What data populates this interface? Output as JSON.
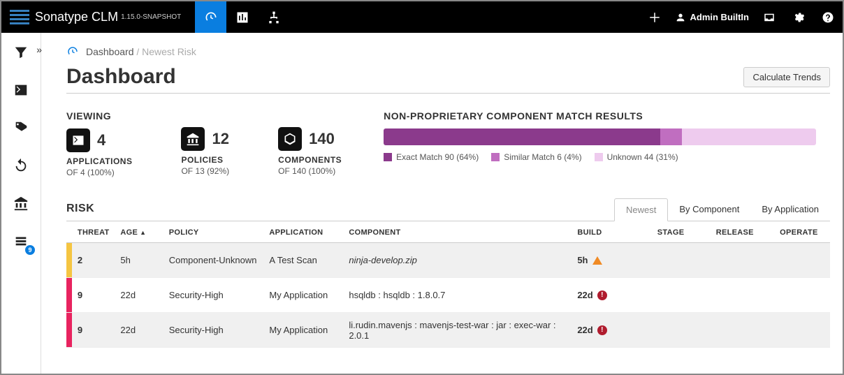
{
  "brand": {
    "name": "Sonatype CLM",
    "version": "1.15.0-SNAPSHOT"
  },
  "user": {
    "name": "Admin BuiltIn"
  },
  "breadcrumb": {
    "link": "Dashboard",
    "current": "Newest Risk"
  },
  "page": {
    "title": "Dashboard",
    "button": "Calculate Trends"
  },
  "viewing": {
    "title": "VIEWING",
    "applications": {
      "num": "4",
      "label": "APPLICATIONS",
      "sub": "OF 4 (100%)"
    },
    "policies": {
      "num": "12",
      "label": "POLICIES",
      "sub": "OF 13 (92%)"
    },
    "components": {
      "num": "140",
      "label": "COMPONENTS",
      "sub": "OF 140 (100%)"
    }
  },
  "match": {
    "title": "NON-PROPRIETARY COMPONENT MATCH RESULTS",
    "legend": {
      "exact": "Exact Match 90 (64%)",
      "similar": "Similar Match 6 (4%)",
      "unknown": "Unknown 44 (31%)"
    },
    "widths": {
      "exact": 64,
      "similar": 5,
      "unknown": 31
    }
  },
  "risk": {
    "title": "RISK",
    "tabs": [
      "Newest",
      "By Component",
      "By Application"
    ],
    "activeTab": 0,
    "columns": {
      "threat": "THREAT",
      "age": "AGE",
      "policy": "POLICY",
      "application": "APPLICATION",
      "component": "COMPONENT",
      "build": "BUILD",
      "stage": "STAGE",
      "release": "RELEASE",
      "operate": "OPERATE"
    },
    "rows": [
      {
        "threat": "2",
        "age": "5h",
        "policy": "Component-Unknown",
        "app": "A Test Scan",
        "component": "ninja-develop.zip",
        "componentItalic": true,
        "build": "5h",
        "buildIcon": "warn",
        "barClass": "low",
        "alt": true
      },
      {
        "threat": "9",
        "age": "22d",
        "policy": "Security-High",
        "app": "My Application",
        "component": "hsqldb : hsqldb : 1.8.0.7",
        "componentItalic": false,
        "build": "22d",
        "buildIcon": "err",
        "barClass": "high",
        "alt": false
      },
      {
        "threat": "9",
        "age": "22d",
        "policy": "Security-High",
        "app": "My Application",
        "component": "li.rudin.mavenjs : mavenjs-test-war : jar : exec-war : 2.0.1",
        "componentItalic": false,
        "build": "22d",
        "buildIcon": "err",
        "barClass": "high",
        "alt": true
      }
    ]
  },
  "sidebar": {
    "badge": "9"
  }
}
